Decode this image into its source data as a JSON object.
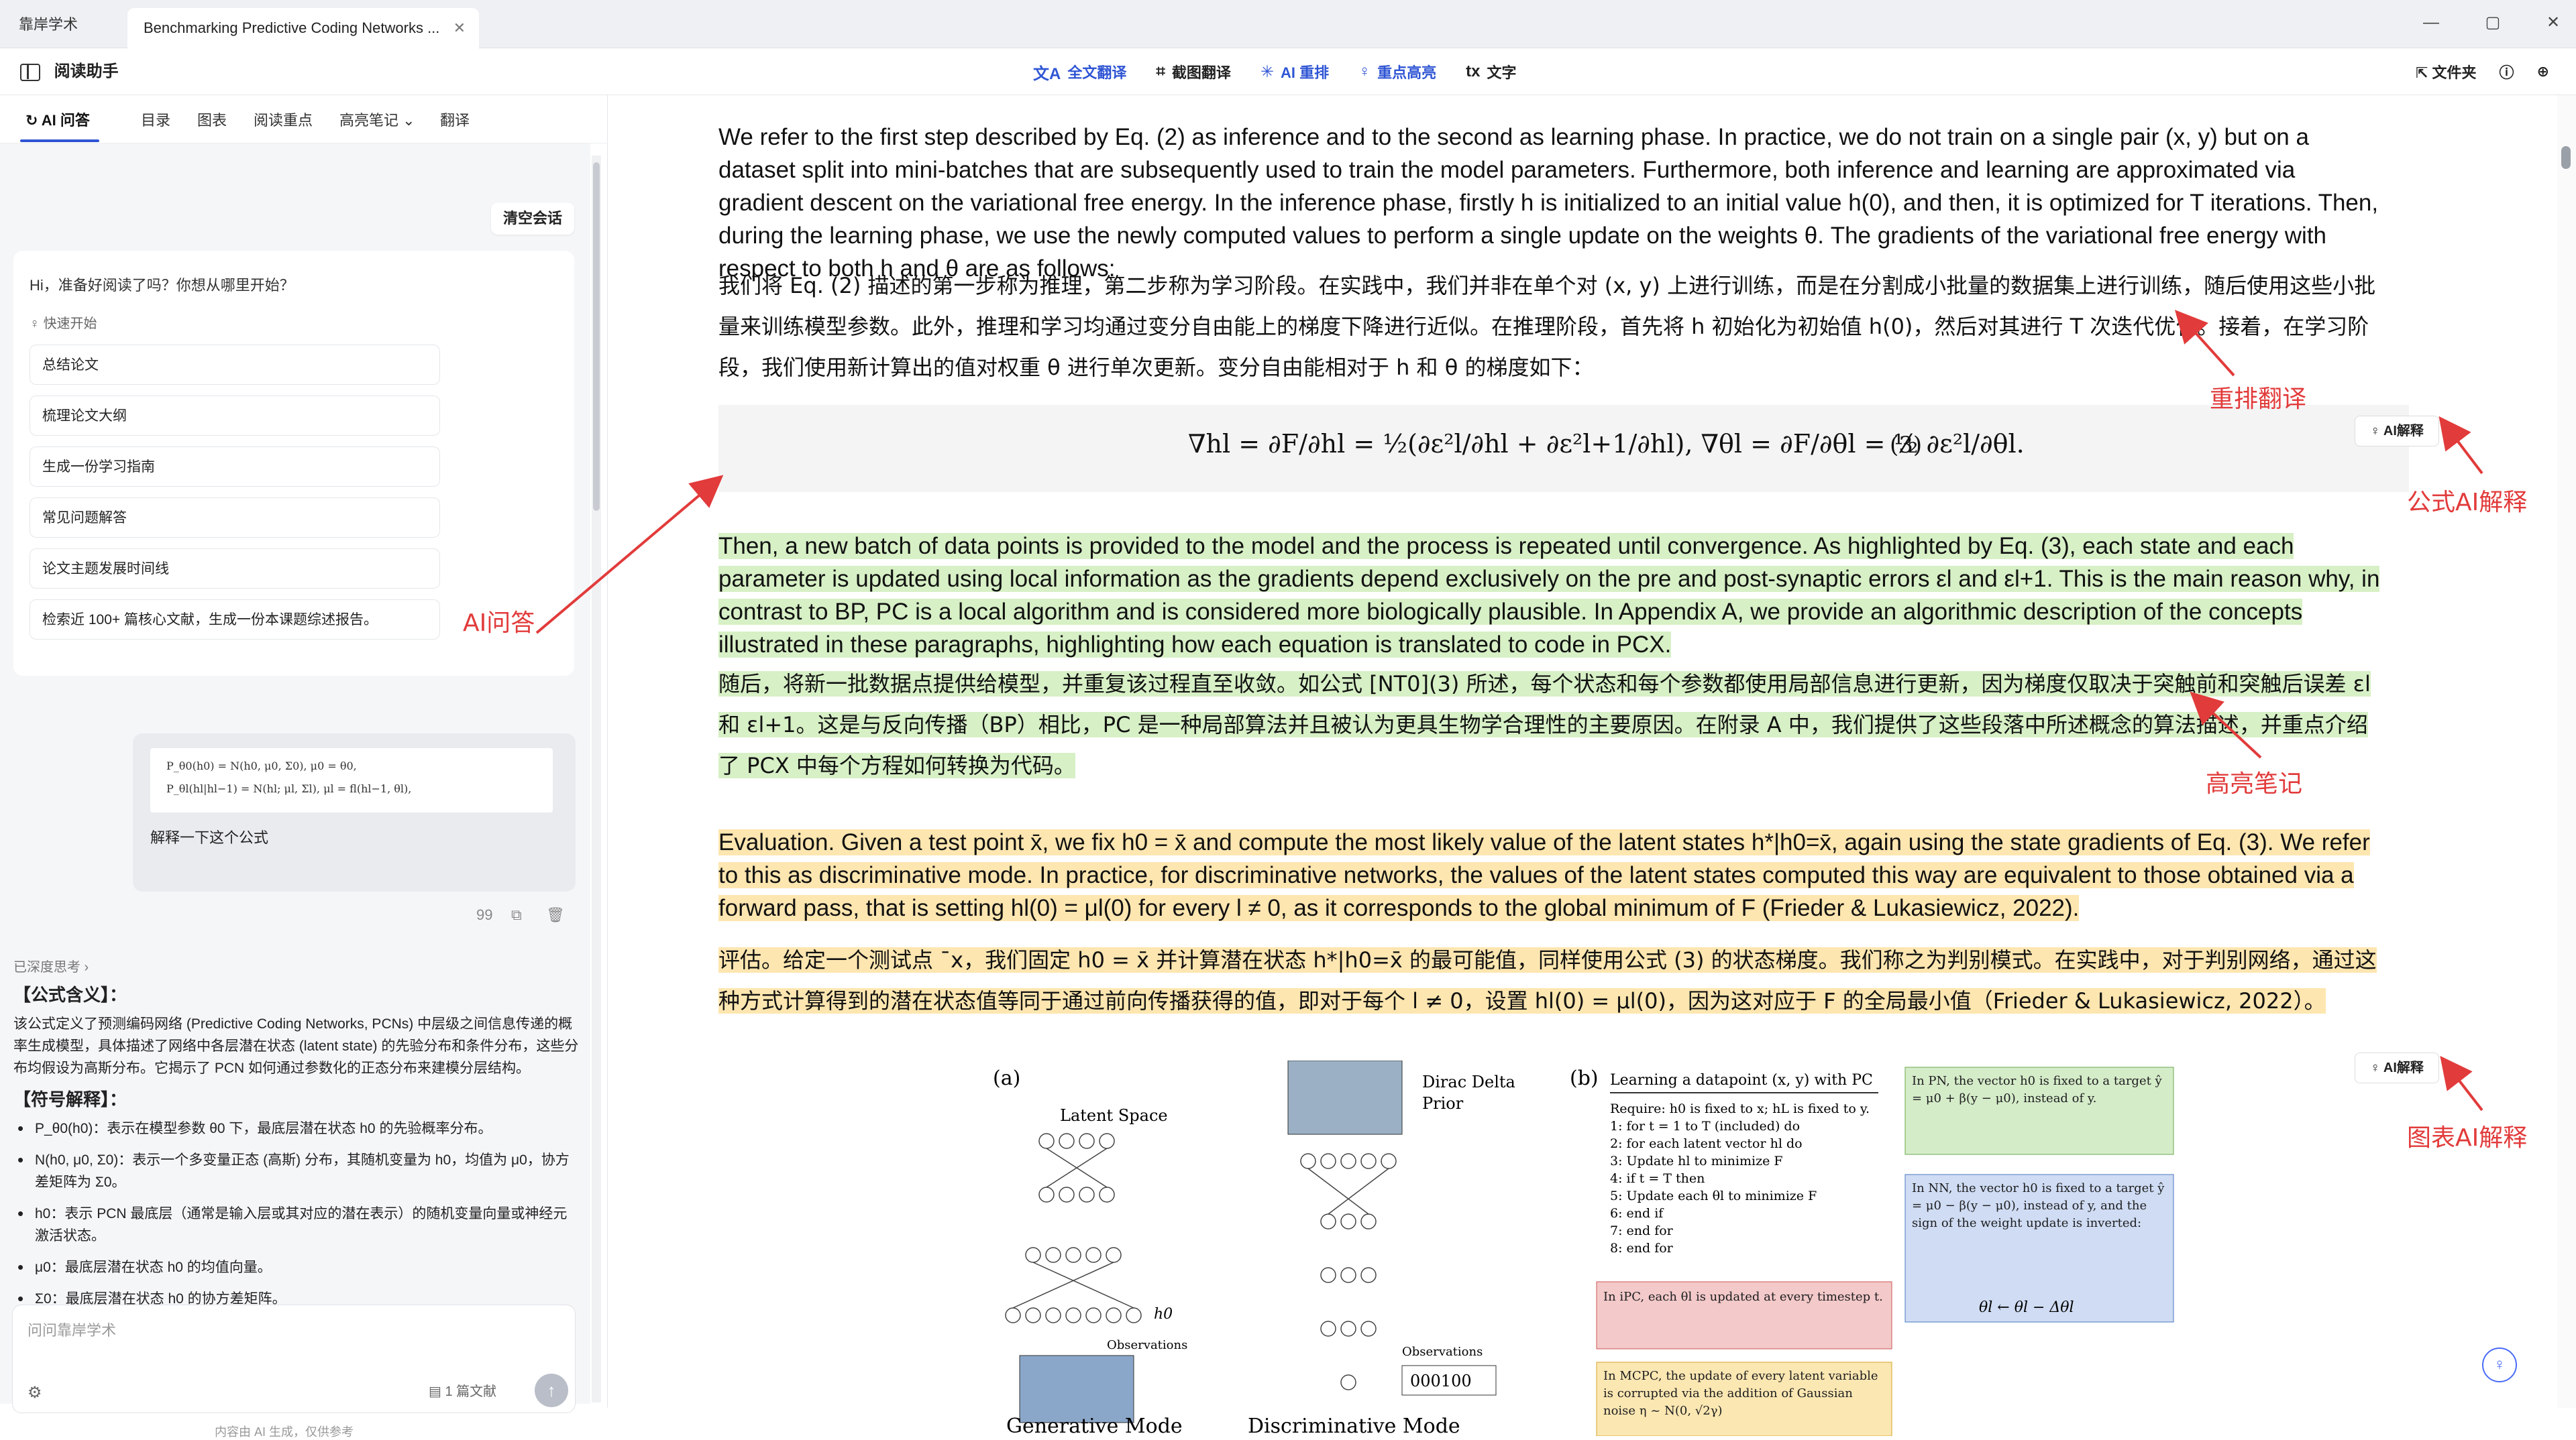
{
  "window": {
    "app_tab": "靠岸学术",
    "doc_tab": "Benchmarking Predictive Coding Networks ...",
    "controls": [
      "—",
      "▢",
      "✕"
    ]
  },
  "toolbar": {
    "left_label": "阅读助手",
    "tools": [
      {
        "label": "全文翻译",
        "icon": "translate-icon"
      },
      {
        "label": "截图翻译",
        "icon": "crop-icon"
      },
      {
        "label": "AI 重排",
        "icon": "sparkle-icon"
      },
      {
        "label": "重点高亮",
        "icon": "bulb-icon"
      },
      {
        "label": "文字",
        "icon": "text-icon"
      }
    ],
    "folder_label": "文件夹",
    "accent_color": "#2f55d4"
  },
  "sidebar": {
    "tabs": [
      "AI 问答",
      "目录",
      "图表",
      "阅读重点",
      "高亮笔记",
      "翻译"
    ],
    "clear_button": "清空会话",
    "greeting": "Hi，准备好阅读了吗？你想从哪里开始？",
    "quick_start": "快速开始",
    "quick_items": [
      "总结论文",
      "梳理论文大纲",
      "生成一份学习指南",
      "常见问题解答",
      "论文主题发展时间线",
      "检索近 100+ 篇核心文献，生成一份本课题综述报告。"
    ],
    "user_formula_line1": "P_θ0(h0) = N(h0, μ0, Σ0),      μ0 = θ0,",
    "user_formula_line2": "P_θl(hl|hl−1) = N(hl; μl, Σl),   μl = fl(hl−1, θl),",
    "user_message": "解释一下这个公式",
    "msg_controls": [
      "99",
      "⧉",
      "🗑"
    ],
    "thinking": "已深度思考 ›",
    "answer_h1": "【公式含义】：",
    "answer_p1": "该公式定义了预测编码网络 (Predictive Coding Networks, PCNs) 中层级之间信息传递的概率生成模型，具体描述了网络中各层潜在状态 (latent state) 的先验分布和条件分布，这些分布均假设为高斯分布。它揭示了 PCN 如何通过参数化的正态分布来建模分层结构。",
    "answer_h2": "【符号解释】：",
    "answer_items": [
      "P_θ0(h0)：表示在模型参数 θ0 下，最底层潜在状态 h0 的先验概率分布。",
      "N(h0, μ0, Σ0)：表示一个多变量正态 (高斯) 分布，其随机变量为 h0，均值为 μ0，协方差矩阵为 Σ0。",
      "h0：表示 PCN 最底层（通常是输入层或其对应的潜在表示）的随机变量向量或神经元激活状态。",
      "μ0：最底层潜在状态 h0 的均值向量。",
      "Σ0：最底层潜在状态 h0 的协方差矩阵。"
    ],
    "input_placeholder": "问问靠岸学术",
    "input_docs": "1 篇文献",
    "disclaimer": "内容由 AI 生成，仅供参考"
  },
  "document": {
    "para1": "We refer to the first step described by Eq. (2) as inference and to the second as learning phase. In practice, we do not train on a single pair (x, y) but on a dataset split into mini-batches that are subsequently used to train the model parameters. Furthermore, both inference and learning are approximated via gradient descent on the variational free energy. In the inference phase, firstly h is initialized to an initial value h(0), and then, it is optimized for T iterations. Then, during the learning phase, we use the newly computed values to perform a single update on the weights θ. The gradients of the variational free energy with respect to both h and θ are as follows:",
    "para1_cn": "我们将 Eq. (2) 描述的第一步称为推理，第二步称为学习阶段。在实践中，我们并非在单个对 (x, y) 上进行训练，而是在分割成小批量的数据集上进行训练，随后使用这些小批量来训练模型参数。此外，推理和学习均通过变分自由能上的梯度下降进行近似。在推理阶段，首先将 h 初始化为初始值 h(0)，然后对其进行 T 次迭代优化。接着，在学习阶段，我们使用新计算出的值对权重 θ 进行单次更新。变分自由能相对于 h 和 θ 的梯度如下：",
    "equation": "∇hl = ∂F/∂hl = ½(∂ε²l/∂hl + ∂ε²l+1/∂hl),   ∇θl = ∂F/∂θl = ½ ∂ε²l/∂θl.",
    "eq_number": "(3)",
    "ai_explain": "AI解释",
    "para2": "Then, a new batch of data points is provided to the model and the process is repeated until convergence. As highlighted by Eq. (3), each state and each parameter is updated using local information as the gradients depend exclusively on the pre and post-synaptic errors εl and εl+1. This is the main reason why, in contrast to BP, PC is a local algorithm and is considered more biologically plausible. In Appendix A, we provide an algorithmic description of the concepts illustrated in these paragraphs, highlighting how each equation is translated to code in PCX.",
    "para2_cn": "随后，将新一批数据点提供给模型，并重复该过程直至收敛。如公式 [NT0](3) 所述，每个状态和每个参数都使用局部信息进行更新，因为梯度仅取决于突触前和突触后误差 εl 和 εl+1。这是与反向传播（BP）相比，PC 是一种局部算法并且被认为更具生物学合理性的主要原因。在附录 A 中，我们提供了这些段落中所述概念的算法描述，并重点介绍了 PCX 中每个方程如何转换为代码。",
    "para3": "Evaluation. Given a test point x̄, we fix h0 = x̄ and compute the most likely value of the latent states h*|h0=x̄, again using the state gradients of Eq. (3). We refer to this as discriminative mode. In practice, for discriminative networks, the values of the latent states computed this way are equivalent to those obtained via a forward pass, that is setting hl(0) = μl(0) for every l ≠ 0, as it corresponds to the global minimum of F (Frieder & Lukasiewicz, 2022).",
    "para3_cn": "评估。给定一个测试点 ¯x，我们固定 h0 = x̄ 并计算潜在状态 h*|h0=x̄ 的最可能值，同样使用公式 (3) 的状态梯度。我们称之为判别模式。在实践中，对于判别网络，通过这种方式计算得到的潜在状态值等同于通过前向传播获得的值，即对于每个 l ≠ 0，设置 hl(0) = μl(0)，因为这对应于 F 的全局最小值（Frieder & Lukasiewicz, 2022）。"
  },
  "figure": {
    "label_a": "(a)",
    "label_b": "(b)",
    "latent_space": "Latent Space",
    "dirac_line1": "Dirac Delta",
    "dirac_line2": "Prior",
    "observations": "Observations",
    "obs_digits": "000100",
    "gen_caption": "Generative Mode",
    "disc_caption": "Discriminative Mode",
    "algo_title": "Learning a datapoint (x, y) with PC",
    "algo_lines": [
      "Require: h0 is fixed to x; hL is fixed to y.",
      "1: for t = 1 to T (included) do",
      "2:   for each latent vector hl do",
      "3:     Update hl to minimize F",
      "4:     if t = T then",
      "5:       Update each θl to minimize F",
      "6:     end if",
      "7:   end for",
      "8: end for"
    ],
    "pn_box": "In PN, the vector h0 is fixed to a target ŷ = μ0 + β(y − μ0), instead of y.",
    "nn_box": "In NN, the vector h0 is fixed to a target ŷ = μ0 − β(y − μ0), instead of y, and the sign of the weight update is inverted:",
    "nn_eq": "θl ← θl − Δθl",
    "ipc_box": "In iPC, each θl is updated at every timestep t.",
    "mcpc_box": "In MCPC, the update of every latent variable is corrupted via the addition of Gaussian noise η ~ N(0, √2γ)"
  },
  "annotations": {
    "rearrange": "重排翻译",
    "formula_ai": "公式AI解释",
    "ai_qa": "AI问答",
    "highlight_notes": "高亮笔记",
    "chart_ai": "图表AI解释",
    "color": "#e23b3b"
  }
}
